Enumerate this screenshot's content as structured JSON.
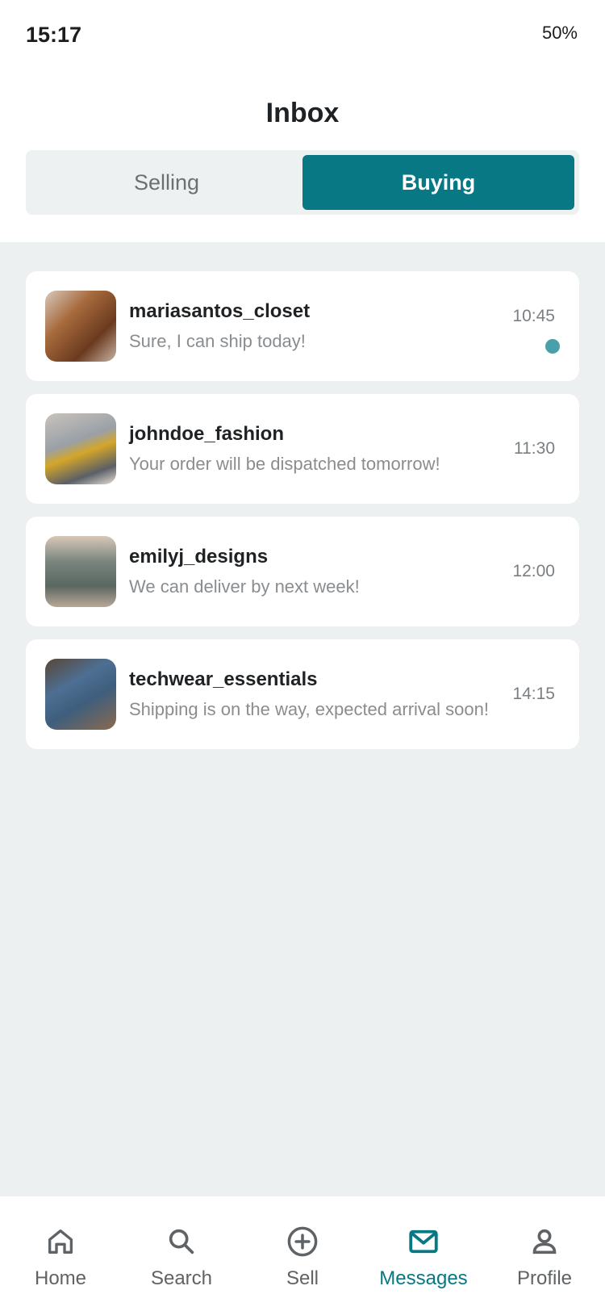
{
  "status_bar": {
    "time": "15:17",
    "battery": "50%"
  },
  "header": {
    "title": "Inbox"
  },
  "tabs": [
    {
      "label": "Selling",
      "active": false
    },
    {
      "label": "Buying",
      "active": true
    }
  ],
  "conversations": [
    {
      "name": "mariasantos_closet",
      "message": "Sure, I can ship today!",
      "time": "10:45",
      "unread": true
    },
    {
      "name": "johndoe_fashion",
      "message": "Your order will be dispatched tomorrow!",
      "time": "11:30",
      "unread": false
    },
    {
      "name": "emilyj_designs",
      "message": "We can deliver by next week!",
      "time": "12:00",
      "unread": false
    },
    {
      "name": "techwear_essentials",
      "message": "Shipping is on the way, expected arrival soon!",
      "time": "14:15",
      "unread": false
    }
  ],
  "bottom_nav": [
    {
      "label": "Home",
      "icon": "home-icon",
      "active": false
    },
    {
      "label": "Search",
      "icon": "search-icon",
      "active": false
    },
    {
      "label": "Sell",
      "icon": "plus-circle-icon",
      "active": false
    },
    {
      "label": "Messages",
      "icon": "mail-icon",
      "active": true
    },
    {
      "label": "Profile",
      "icon": "user-icon",
      "active": false
    }
  ],
  "colors": {
    "accent": "#077884",
    "background": "#ecf0f1",
    "unread_dot": "#4aa0a8"
  }
}
